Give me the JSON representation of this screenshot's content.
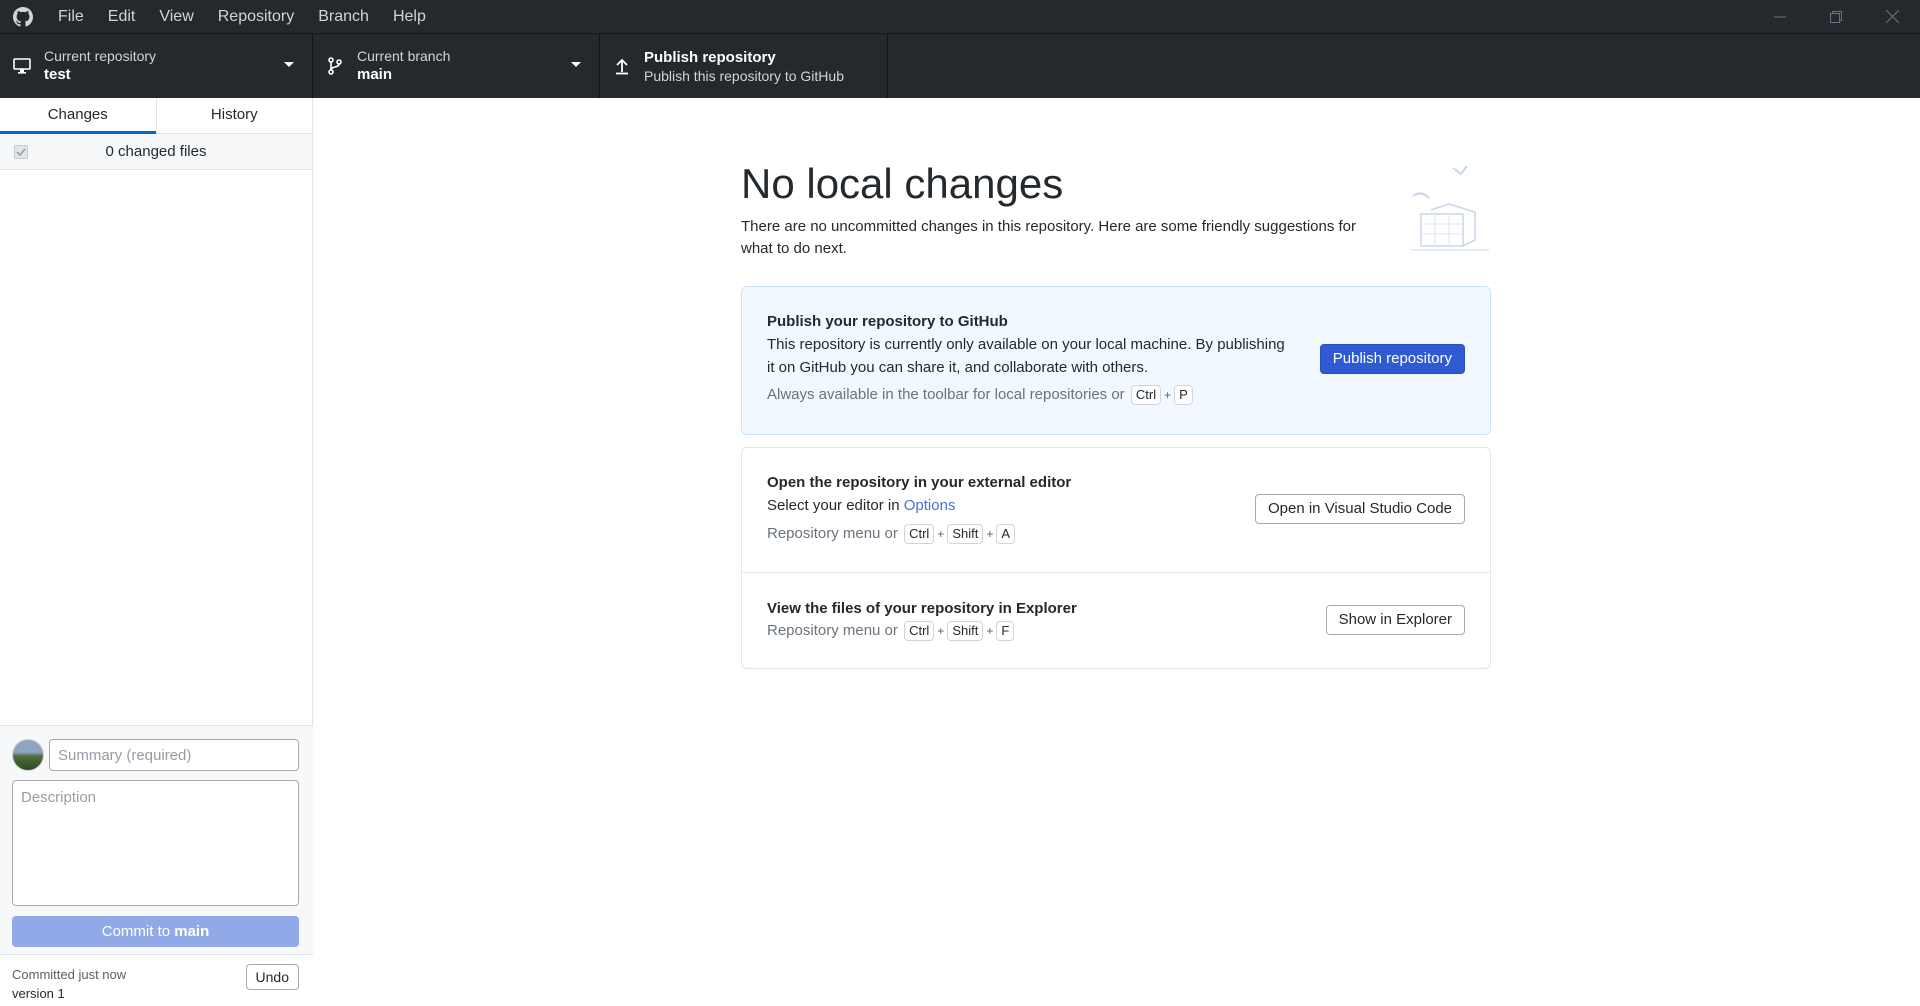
{
  "menu": [
    "File",
    "Edit",
    "View",
    "Repository",
    "Branch",
    "Help"
  ],
  "toolbar": {
    "repo_label": "Current repository",
    "repo_value": "test",
    "branch_label": "Current branch",
    "branch_value": "main",
    "publish_title": "Publish repository",
    "publish_sub": "Publish this repository to GitHub"
  },
  "sidebar": {
    "tabs": [
      "Changes",
      "History"
    ],
    "changed_files": "0 changed files",
    "summary_placeholder": "Summary (required)",
    "description_placeholder": "Description",
    "commit_prefix": "Commit to ",
    "commit_branch": "main",
    "last_commit_label": "Committed just now",
    "last_commit_message": "version 1",
    "undo_label": "Undo"
  },
  "main": {
    "title": "No local changes",
    "lead": "There are no uncommitted changes in this repository. Here are some friendly suggestions for what to do next.",
    "publish_card": {
      "title": "Publish your repository to GitHub",
      "desc": "This repository is currently only available on your local machine. By publishing it on GitHub you can share it, and collaborate with others.",
      "hint": "Always available in the toolbar for local repositories or",
      "keys": [
        "Ctrl",
        "P"
      ],
      "button": "Publish repository"
    },
    "editor_card": {
      "title": "Open the repository in your external editor",
      "desc_prefix": "Select your editor in ",
      "desc_link": "Options",
      "hint": "Repository menu or",
      "keys": [
        "Ctrl",
        "Shift",
        "A"
      ],
      "button": "Open in Visual Studio Code"
    },
    "explorer_card": {
      "title": "View the files of your repository in Explorer",
      "hint": "Repository menu or",
      "keys": [
        "Ctrl",
        "Shift",
        "F"
      ],
      "button": "Show in Explorer"
    }
  },
  "colors": {
    "titlebar": "#24292e",
    "primary_button": "#2f5bd2",
    "commit_button_disabled": "#91a9e6",
    "tab_underline": "#0366d6"
  }
}
